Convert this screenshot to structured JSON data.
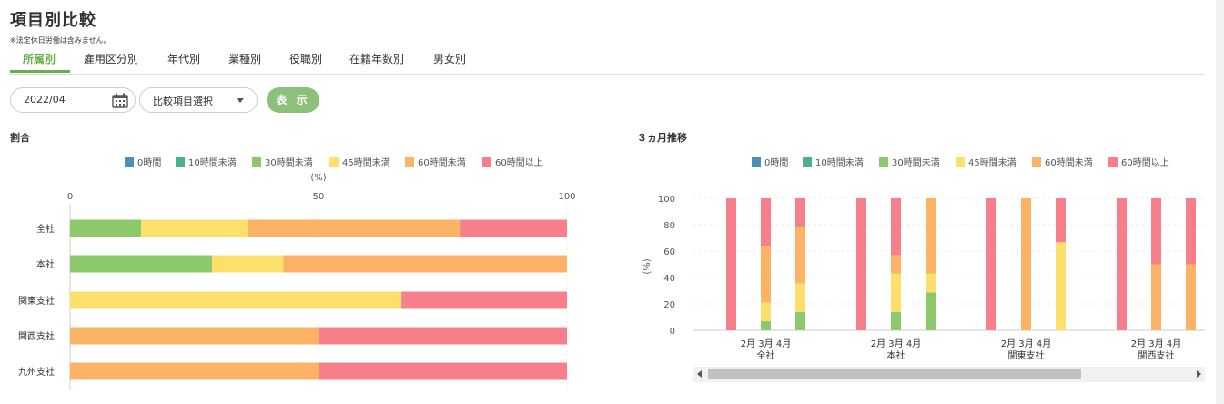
{
  "page": {
    "title": "項目別比較",
    "note": "※法定休日労働は含みません。"
  },
  "tabs": [
    {
      "label": "所属別",
      "active": true
    },
    {
      "label": "雇用区分別",
      "active": false
    },
    {
      "label": "年代別",
      "active": false
    },
    {
      "label": "業種別",
      "active": false
    },
    {
      "label": "役職別",
      "active": false
    },
    {
      "label": "在籍年数別",
      "active": false
    },
    {
      "label": "男女別",
      "active": false
    }
  ],
  "controls": {
    "date_value": "2022/04",
    "select_value": "比較項目選択",
    "show_button": "表 示"
  },
  "colors": {
    "accent": "#6ab04c",
    "button": "#8bc17a"
  },
  "legend": [
    {
      "name": "0時間",
      "color": "#4a90b8"
    },
    {
      "name": "10時間未満",
      "color": "#4caf8e"
    },
    {
      "name": "30時間未満",
      "color": "#8bc96a"
    },
    {
      "name": "45時間未満",
      "color": "#fde06b"
    },
    {
      "name": "60時間未満",
      "color": "#fdb366"
    },
    {
      "name": "60時間以上",
      "color": "#f77f8b"
    }
  ],
  "chart_data": [
    {
      "type": "bar",
      "orientation": "horizontal",
      "stacked": true,
      "title": "割合",
      "xlabel": "(%)",
      "xlim": [
        0,
        100
      ],
      "xticks": [
        0,
        50,
        100
      ],
      "categories": [
        "全社",
        "本社",
        "関東支社",
        "関西支社",
        "九州支社"
      ],
      "series": [
        {
          "name": "0時間",
          "values": [
            0,
            0,
            0,
            0,
            0
          ]
        },
        {
          "name": "10時間未満",
          "values": [
            0,
            0,
            0,
            0,
            0
          ]
        },
        {
          "name": "30時間未満",
          "values": [
            14.3,
            28.6,
            0,
            0,
            0
          ]
        },
        {
          "name": "45時間未満",
          "values": [
            21.4,
            14.3,
            66.7,
            0,
            0
          ]
        },
        {
          "name": "60時間未満",
          "values": [
            42.9,
            57.1,
            0,
            50,
            50
          ]
        },
        {
          "name": "60時間以上",
          "values": [
            21.4,
            0,
            33.3,
            50,
            50
          ]
        }
      ],
      "legend_position": "top",
      "grid": true
    },
    {
      "type": "bar",
      "stacked": true,
      "title": "３ヵ月推移",
      "ylabel": "(%)",
      "ylim": [
        0,
        100
      ],
      "yticks": [
        0,
        20,
        40,
        60,
        80,
        100
      ],
      "groups": [
        {
          "name": "全社",
          "months": [
            "2月",
            "3月",
            "4月"
          ]
        },
        {
          "name": "本社",
          "months": [
            "2月",
            "3月",
            "4月"
          ]
        },
        {
          "name": "関東支社",
          "months": [
            "2月",
            "3月",
            "4月"
          ]
        },
        {
          "name": "関西支社",
          "months": [
            "2月",
            "3月",
            "4月"
          ]
        }
      ],
      "series": [
        {
          "name": "0時間",
          "values": [
            [
              0,
              0,
              0
            ],
            [
              0,
              0,
              0
            ],
            [
              0,
              0,
              0
            ],
            [
              0,
              0,
              0
            ]
          ]
        },
        {
          "name": "10時間未満",
          "values": [
            [
              0,
              0,
              0
            ],
            [
              0,
              0,
              0
            ],
            [
              0,
              0,
              0
            ],
            [
              0,
              0,
              0
            ]
          ]
        },
        {
          "name": "30時間未満",
          "values": [
            [
              0,
              7,
              14
            ],
            [
              0,
              14,
              28.6
            ],
            [
              0,
              0,
              0
            ],
            [
              0,
              0,
              0
            ]
          ]
        },
        {
          "name": "45時間未満",
          "values": [
            [
              0,
              14,
              21.4
            ],
            [
              0,
              29,
              14.3
            ],
            [
              0,
              0,
              66.7
            ],
            [
              0,
              0,
              0
            ]
          ]
        },
        {
          "name": "60時間未満",
          "values": [
            [
              0,
              43,
              43
            ],
            [
              0,
              14,
              57.1
            ],
            [
              0,
              100,
              0
            ],
            [
              0,
              50,
              50
            ]
          ]
        },
        {
          "name": "60時間以上",
          "values": [
            [
              100,
              36,
              21.6
            ],
            [
              100,
              43,
              0
            ],
            [
              100,
              0,
              33.3
            ],
            [
              100,
              50,
              50
            ]
          ]
        }
      ],
      "legend_position": "top",
      "grid": true
    }
  ]
}
